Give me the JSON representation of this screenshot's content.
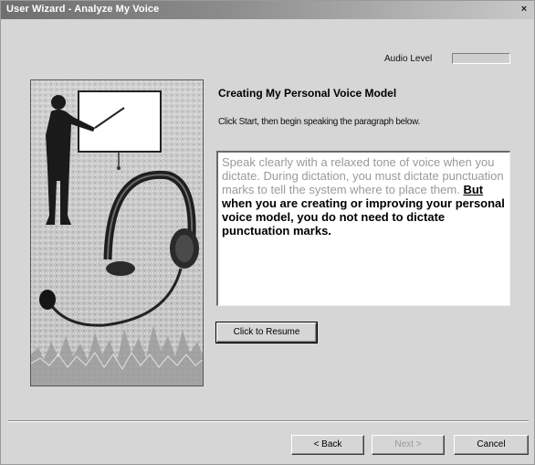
{
  "window": {
    "title": "User Wizard - Analyze My Voice",
    "close_glyph": "×"
  },
  "audio": {
    "label": "Audio Level",
    "level": 0
  },
  "page": {
    "heading": "Creating My Personal Voice Model",
    "instruction": "Click Start, then begin speaking the paragraph below."
  },
  "passage": {
    "read_text": "Speak clearly with a relaxed tone of voice when you dictate.  During dictation, you must dictate punctuation marks to tell the system where to place them. ",
    "current_word": "But",
    "unread_text": " when you are creating or improving your personal voice model, you do not need to dictate punctuation marks."
  },
  "buttons": {
    "resume": "Click to Resume",
    "back": "< Back",
    "next": "Next >",
    "cancel": "Cancel"
  },
  "icons": {
    "illustration": "presenter-with-headset-illustration",
    "close": "close-icon"
  }
}
